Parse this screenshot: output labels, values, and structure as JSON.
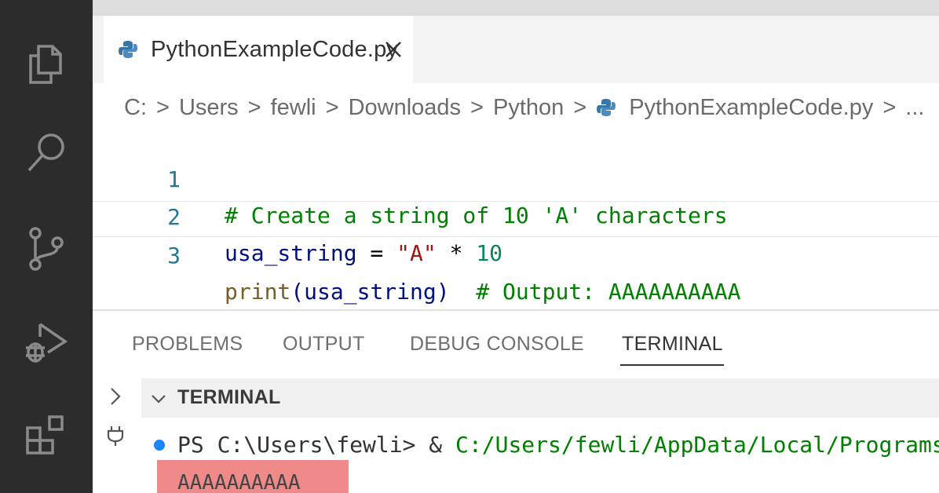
{
  "activity_bar": {
    "icons": [
      "explorer-icon",
      "search-icon",
      "source-control-icon",
      "run-debug-icon",
      "extensions-icon"
    ]
  },
  "editor_tab": {
    "filename": "PythonExampleCode.py",
    "close_glyph": "×"
  },
  "breadcrumb": {
    "items": [
      "C:",
      "Users",
      "fewli",
      "Downloads",
      "Python",
      "PythonExampleCode.py",
      "..."
    ]
  },
  "editor": {
    "lines": [
      {
        "number": "1",
        "comment": "# Create a string of 10 'A' characters"
      },
      {
        "number": "2",
        "var": "usa_string",
        "op": " = ",
        "str": "\"A\"",
        "mul": " * ",
        "num": "10"
      },
      {
        "number": "3",
        "fn": "print",
        "args": "(usa_string)",
        "comment": "  # Output: AAAAAAAAAA"
      }
    ]
  },
  "panel": {
    "tabs": [
      "PROBLEMS",
      "OUTPUT",
      "DEBUG CONSOLE",
      "TERMINAL"
    ],
    "active_tab": "TERMINAL",
    "terminal_header": "TERMINAL",
    "prompt": "PS C:\\Users\\fewli> & ",
    "command_path": "C:/Users/fewli/AppData/Local/Programs/Python",
    "output": "AAAAAAAAAA"
  },
  "colors": {
    "activity_bar": "#2c2c2c",
    "comment": "#008000",
    "string": "#a31515",
    "number": "#098658",
    "line_number": "#237893",
    "output_highlight": "#f08a8a"
  }
}
